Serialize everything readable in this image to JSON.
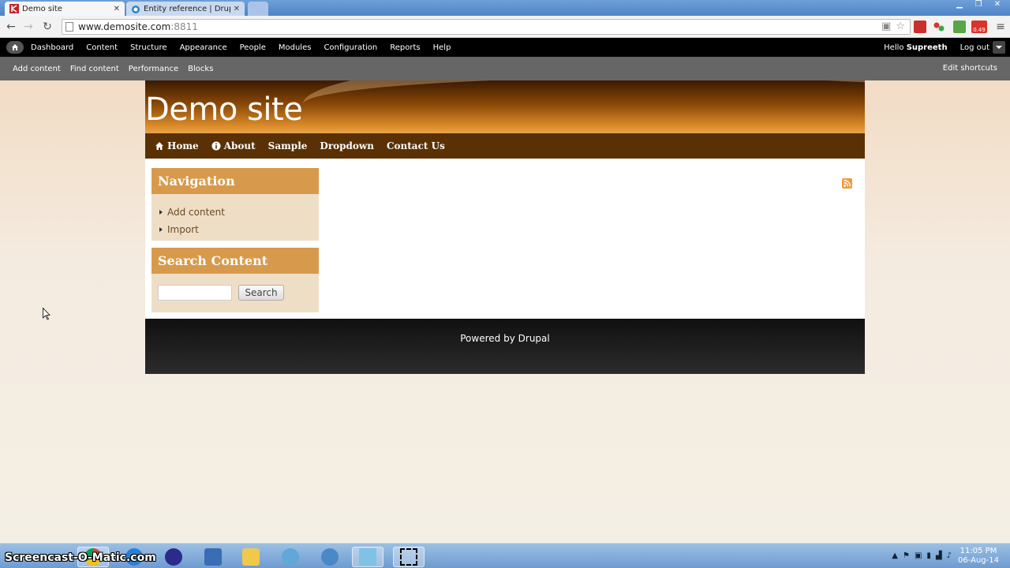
{
  "browser": {
    "tabs": [
      {
        "label": "Demo site"
      },
      {
        "label": "Entity reference | Drupal.o"
      }
    ],
    "address": {
      "host": "www.demosite.com",
      "port": ":8811"
    },
    "extension_badge": "0.49"
  },
  "admin_toolbar": {
    "menu": [
      "Dashboard",
      "Content",
      "Structure",
      "Appearance",
      "People",
      "Modules",
      "Configuration",
      "Reports",
      "Help"
    ],
    "hello": "Hello",
    "user": "Supreeth",
    "logout": "Log out"
  },
  "shortcuts": {
    "items": [
      "Add content",
      "Find content",
      "Performance",
      "Blocks"
    ],
    "edit": "Edit shortcuts"
  },
  "site": {
    "name": "Demo site",
    "main_menu": [
      "Home",
      "About",
      "Sample",
      "Dropdown",
      "Contact Us"
    ],
    "navigation_block": {
      "title": "Navigation",
      "links": [
        "Add content",
        "Import"
      ]
    },
    "search_block": {
      "title": "Search Content",
      "button": "Search",
      "input_value": ""
    },
    "footer": {
      "prefix": "Powered by",
      "link": "Drupal"
    }
  },
  "taskbar": {
    "watermark": "Screencast-O-Matic.com",
    "time": "11:05 PM",
    "date": "06-Aug-14"
  },
  "colors": {
    "admin_bar": "#000000",
    "shortcut_bar": "#666666",
    "block_header": "#d79a4c",
    "block_body": "#efdec6",
    "main_nav": "#5a3104"
  }
}
